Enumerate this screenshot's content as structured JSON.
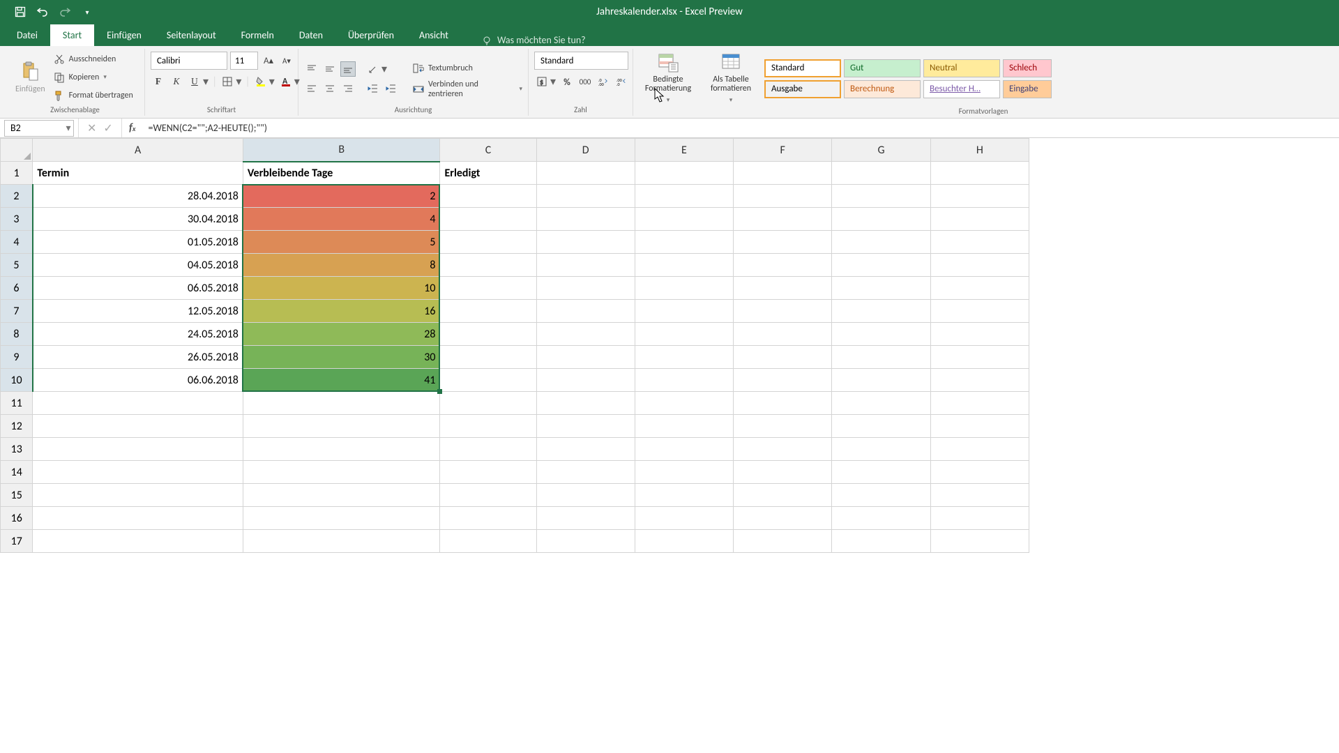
{
  "titlebar": {
    "file": "Jahreskalender.xlsx",
    "app": "Excel Preview",
    "sep": "  -  "
  },
  "tabs": {
    "datei": "Datei",
    "start": "Start",
    "einfuegen": "Einfügen",
    "seitenlayout": "Seitenlayout",
    "formeln": "Formeln",
    "daten": "Daten",
    "ueberpruefen": "Überprüfen",
    "ansicht": "Ansicht",
    "tellme": "Was möchten Sie tun?"
  },
  "ribbon": {
    "clipboard": {
      "paste": "Einfügen",
      "cut": "Ausschneiden",
      "copy": "Kopieren",
      "format_painter": "Format übertragen",
      "group": "Zwischenablage"
    },
    "font": {
      "name": "Calibri",
      "size": "11",
      "group": "Schriftart"
    },
    "alignment": {
      "wrap": "Textumbruch",
      "merge": "Verbinden und zentrieren",
      "group": "Ausrichtung"
    },
    "number": {
      "format": "Standard",
      "group": "Zahl"
    },
    "styles": {
      "cond_fmt": "Bedingte Formatierung",
      "as_table": "Als Tabelle formatieren",
      "s_standard": "Standard",
      "s_gut": "Gut",
      "s_neutral": "Neutral",
      "s_schlecht": "Schlech",
      "s_ausgabe": "Ausgabe",
      "s_berechnung": "Berechnung",
      "s_besuchter": "Besuchter H…",
      "s_eingabe": "Eingabe",
      "group": "Formatvorlagen"
    }
  },
  "formulabar": {
    "namebox": "B2",
    "formula": "=WENN(C2=\"\";A2-HEUTE();\"\")"
  },
  "columns": [
    "A",
    "B",
    "C",
    "D",
    "E",
    "F",
    "G",
    "H"
  ],
  "headers": {
    "A": "Termin",
    "B": "Verbleibende Tage",
    "C": "Erledigt"
  },
  "rows": [
    {
      "n": "1"
    },
    {
      "n": "2",
      "A": "28.04.2018",
      "B": "2",
      "bg": "#e36a5d"
    },
    {
      "n": "3",
      "A": "30.04.2018",
      "B": "4",
      "bg": "#e1795a"
    },
    {
      "n": "4",
      "A": "01.05.2018",
      "B": "5",
      "bg": "#dd8a57"
    },
    {
      "n": "5",
      "A": "04.05.2018",
      "B": "8",
      "bg": "#d7a152"
    },
    {
      "n": "6",
      "A": "06.05.2018",
      "B": "10",
      "bg": "#ccb450"
    },
    {
      "n": "7",
      "A": "12.05.2018",
      "B": "16",
      "bg": "#b7bd53"
    },
    {
      "n": "8",
      "A": "24.05.2018",
      "B": "28",
      "bg": "#8fba58"
    },
    {
      "n": "9",
      "A": "26.05.2018",
      "B": "30",
      "bg": "#77b358"
    },
    {
      "n": "10",
      "A": "06.06.2018",
      "B": "41",
      "bg": "#5aa556"
    },
    {
      "n": "11"
    },
    {
      "n": "12"
    },
    {
      "n": "13"
    },
    {
      "n": "14"
    },
    {
      "n": "15"
    },
    {
      "n": "16"
    },
    {
      "n": "17"
    }
  ],
  "selection": {
    "col": "B",
    "startRow": 2,
    "endRow": 10
  },
  "chart_data": null
}
